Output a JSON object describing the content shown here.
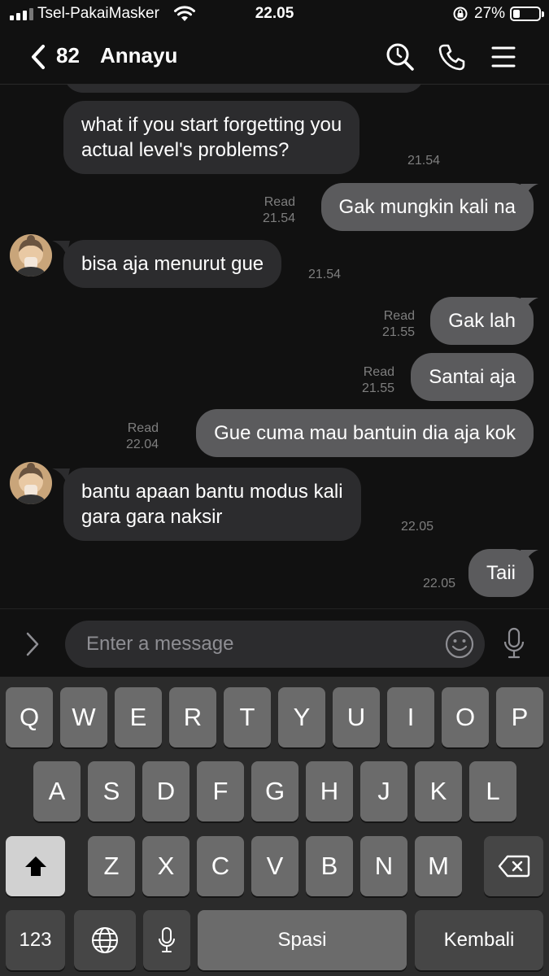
{
  "status_bar": {
    "carrier": "Tsel-PakaiMasker",
    "time": "22.05",
    "battery": "27%",
    "battery_level": 0.27
  },
  "header": {
    "back_count": "82",
    "contact_name": "Annayu"
  },
  "messages": [
    {
      "side": "in",
      "text": "what if you start forgetting you\nactual level's problems?",
      "time": "21.54"
    },
    {
      "side": "out",
      "text": "Gak mungkin kali na",
      "read": "Read",
      "time": "21.54"
    },
    {
      "side": "in",
      "text": "bisa aja menurut gue",
      "time": "21.54"
    },
    {
      "side": "out",
      "text": "Gak lah",
      "read": "Read",
      "time": "21.55"
    },
    {
      "side": "out",
      "text": "Santai aja",
      "read": "Read",
      "time": "21.55"
    },
    {
      "side": "out",
      "text": "Gue cuma mau bantuin dia aja kok",
      "read": "Read",
      "time": "22.04"
    },
    {
      "side": "in",
      "text": "bantu apaan bantu modus kali\ngara gara naksir",
      "time": "22.05"
    },
    {
      "side": "out",
      "text": "Taii",
      "time": "22.05"
    }
  ],
  "input": {
    "placeholder": "Enter a message"
  },
  "keyboard": {
    "row1": [
      "Q",
      "W",
      "E",
      "R",
      "T",
      "Y",
      "U",
      "I",
      "O",
      "P"
    ],
    "row2": [
      "A",
      "S",
      "D",
      "F",
      "G",
      "H",
      "J",
      "K",
      "L"
    ],
    "row3": [
      "Z",
      "X",
      "C",
      "V",
      "B",
      "N",
      "M"
    ],
    "numbers_label": "123",
    "space_label": "Spasi",
    "return_label": "Kembali"
  },
  "colors": {
    "background": "#111111",
    "incoming_bubble": "#2c2c2e",
    "outgoing_bubble": "#5b5b5d",
    "keyboard_bg": "#2b2b2b",
    "key": "#6b6b6b"
  }
}
